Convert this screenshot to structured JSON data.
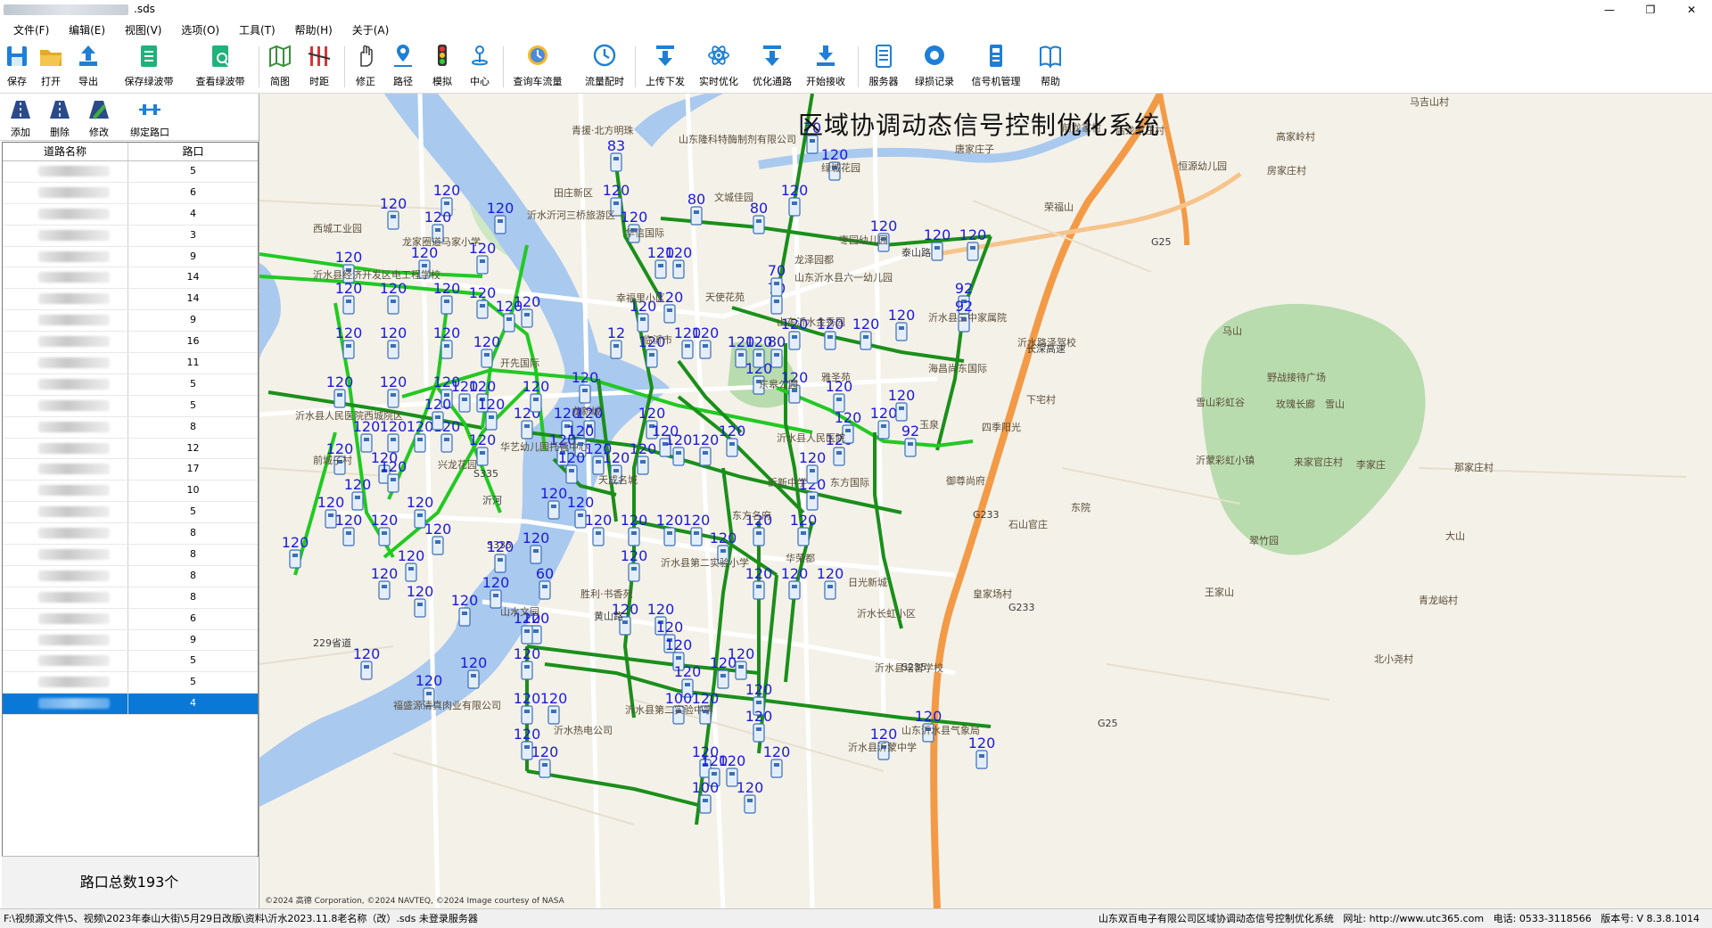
{
  "window": {
    "title": ".sds",
    "controls": [
      "—",
      "❐",
      "✕"
    ]
  },
  "menu": [
    "文件(F)",
    "编辑(E)",
    "视图(V)",
    "选项(O)",
    "工具(T)",
    "帮助(H)",
    "关于(A)"
  ],
  "toolbar": {
    "buttons": [
      "保存",
      "打开",
      "导出",
      "保存绿波带",
      "查看绿波带",
      "简图",
      "时距",
      "修正",
      "路径",
      "模拟",
      "中心",
      "查询车流量",
      "流量配时",
      "上传下发",
      "实时优化",
      "优化通路",
      "开始接收",
      "服务器",
      "绿损记录",
      "信号机管理",
      "帮助"
    ]
  },
  "left_panel": {
    "tools": [
      "添加",
      "删除",
      "修改",
      "绑定路口"
    ],
    "columns": [
      "道路名称",
      "路口"
    ],
    "rows": [
      "5",
      "6",
      "4",
      "3",
      "9",
      "14",
      "14",
      "9",
      "16",
      "11",
      "5",
      "5",
      "8",
      "12",
      "17",
      "10",
      "5",
      "8",
      "8",
      "8",
      "8",
      "6",
      "9",
      "5",
      "5",
      "4"
    ],
    "selected_index": 25,
    "total_label": "路口总数193个"
  },
  "map": {
    "title": "区域协调动态信号控制优化系统",
    "copyright": "©2024 高德 Corporation, ©2024 NAVTEQ, ©2024 Image courtesy of NASA",
    "places": [
      "马吉山村",
      "青援·北方明珠",
      "山东隆科特酶制剂有限公司",
      "田庄新区",
      "文城佳园",
      "华信国际",
      "沂水沂河三桥旅游区",
      "枣园幼儿园",
      "绿城花园",
      "西城工业园",
      "龙家圈道马家小学",
      "沂水县经济开发区电工程学校",
      "龙泽园都",
      "山东沂水县六一幼儿园",
      "幸福里小区",
      "天使花苑",
      "沂水县三中家属院",
      "临沂市",
      "山东沂水金秀园",
      "东皋公园",
      "雅圣苑",
      "海昌尚东国际",
      "沂水路泽驾校",
      "沂水县人民医院西城院区",
      "龙新城",
      "开先国际",
      "华艺幼儿园托管中心",
      "沂水县人民医院",
      "沂新中学",
      "东方国际",
      "玉泉",
      "四季阳光",
      "御尊尚府",
      "兴龙花园",
      "天成名城",
      "东方名府",
      "华荣都",
      "山水文园",
      "胜利·书香苑",
      "日光新城",
      "沂水县第二实验小学",
      "沂水长虹小区",
      "沂水县培智学校",
      "沂水县第二实验中学",
      "沂水县沂蒙中学",
      "山东沂水县气象局",
      "福盛源清真肉业有限公司",
      "沂水热电公司",
      "马山",
      "野战接待广场",
      "雪山彩虹谷",
      "玫瑰长廊",
      "雪山",
      "沂蒙彩虹小镇",
      "翠竹园",
      "大山",
      "荣福山",
      "恒源幼儿园",
      "后龙家庄村",
      "高家岭村",
      "前龙家村",
      "唐家庄子",
      "房家庄村",
      "下宅村",
      "东院",
      "石山官庄",
      "皇家场村",
      "王家山",
      "北小尧村",
      "青龙峪村",
      "来家官庄村",
      "那家庄村",
      "李家庄",
      "前城子村"
    ],
    "road_labels": [
      "泰山路",
      "黄山路",
      "长深高速",
      "G233",
      "G25",
      "S335",
      "S235",
      "沂河",
      "229省道"
    ],
    "signal_values": [
      "120",
      "83",
      "80",
      "70",
      "60",
      "92",
      "100",
      "12"
    ]
  },
  "status": {
    "path": "F:\\视频源文件\\5、视频\\2023年泰山大街\\5月29日改版\\资料\\沂水2023.11.8老名称（改）.sds   未登录服务器",
    "company": "山东双百电子有限公司区域协调动态信号控制优化系统",
    "website": "网址:  http://www.utc365.com",
    "phone": "电话:  0533-3118566",
    "version": "版本号:  V 8.3.8.1014"
  }
}
